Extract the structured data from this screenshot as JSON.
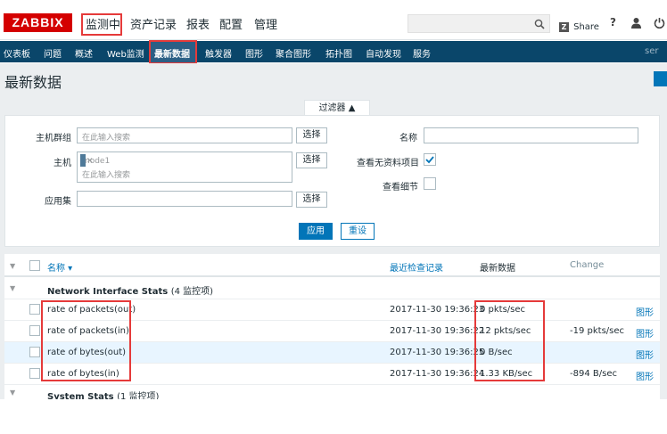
{
  "header": {
    "logo": "ZABBIX",
    "nav": [
      "监测中",
      "资产记录",
      "报表",
      "配置",
      "管理"
    ],
    "search_icon": "search-icon",
    "share": "Share",
    "share_icon": "Z",
    "help": "?",
    "user_icon": "user-icon",
    "power_icon": "power-icon"
  },
  "subnav": {
    "items": [
      "仪表板",
      "问题",
      "概述",
      "Web监测",
      "最新数据",
      "触发器",
      "图形",
      "聚合图形",
      "拓扑图",
      "自动发现",
      "服务"
    ],
    "right_text": "ser"
  },
  "page": {
    "title": "最新数据"
  },
  "filter": {
    "tab_label": "过滤器 ▲",
    "host_group_label": "主机群组",
    "host_group_placeholder": "在此输入搜索",
    "host_label": "主机",
    "host_tag": "node1",
    "host_tag_remove": "✕",
    "host_placeholder": "在此输入搜索",
    "app_label": "应用集",
    "select_label": "选择",
    "name_label": "名称",
    "show_without_data_label": "查看无资料项目",
    "show_details_label": "查看细节",
    "apply_label": "应用",
    "reset_label": "重设"
  },
  "table": {
    "headers": {
      "name": "名称 ▾",
      "last_check": "最近检查记录",
      "last_value": "最新数据",
      "change": "Change"
    },
    "group1": {
      "name": "Network Interface Stats",
      "count": "(4 监控项)"
    },
    "rows": [
      {
        "name": "rate of packets(out)",
        "last_check": "2017-11-30 19:36:23",
        "last_value": "0 pkts/sec",
        "change": "",
        "link": "图形"
      },
      {
        "name": "rate of packets(in)",
        "last_check": "2017-11-30 19:36:22",
        "last_value": "12 pkts/sec",
        "change": "-19 pkts/sec",
        "link": "图形"
      },
      {
        "name": "rate of bytes(out)",
        "last_check": "2017-11-30 19:36:25",
        "last_value": "0 B/sec",
        "change": "",
        "link": "图形"
      },
      {
        "name": "rate of bytes(in)",
        "last_check": "2017-11-30 19:36:24",
        "last_value": "1.33 KB/sec",
        "change": "-894 B/sec",
        "link": "图形"
      }
    ],
    "group2": {
      "name": "System Stats",
      "count": "(1 监控项)"
    }
  },
  "colors": {
    "brand": "#d40000",
    "nav_bg": "#0a466a",
    "link": "#0275b8",
    "highlight": "#e53a3a"
  }
}
